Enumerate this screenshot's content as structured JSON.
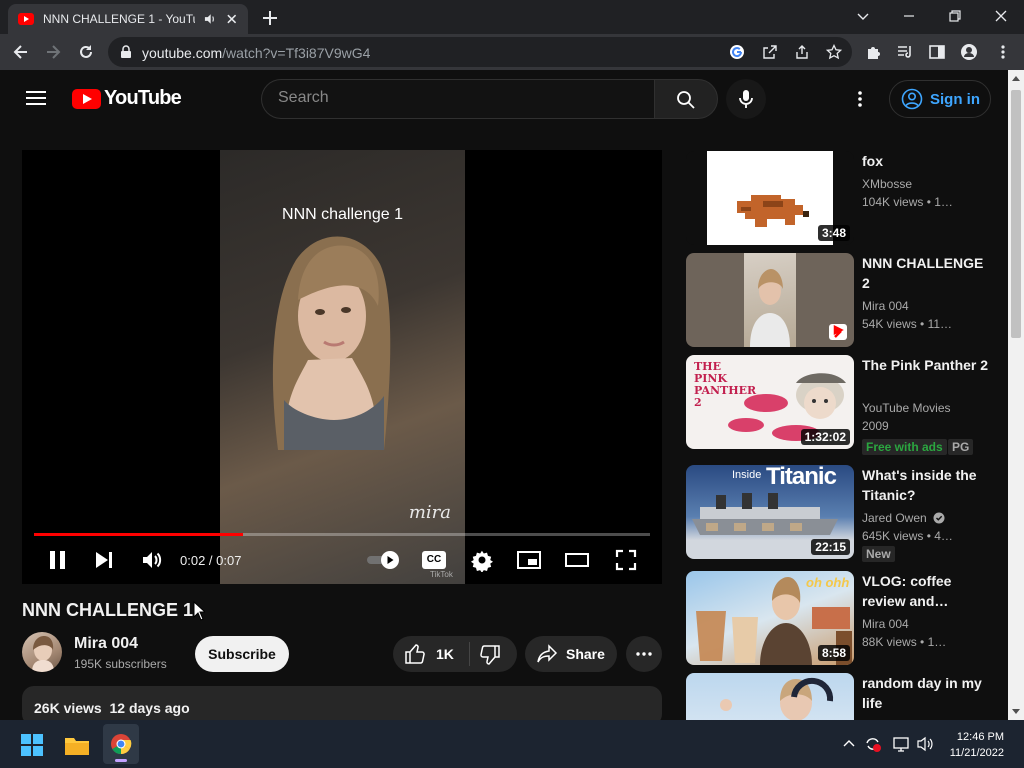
{
  "browser": {
    "tab_title": "NNN CHALLENGE 1 - YouTube",
    "url_domain": "youtube.com",
    "url_path": "/watch?v=Tf3i87V9wG4"
  },
  "header": {
    "logo_text": "YouTube",
    "search_placeholder": "Search",
    "signin_label": "Sign in"
  },
  "player": {
    "caption_text": "NNN challenge 1",
    "watermark": "mira",
    "tiktok_label": "TikTok",
    "timecode": "0:02 / 0:07",
    "cc_label": "CC",
    "progress": 0.34
  },
  "video": {
    "title": "NNN CHALLENGE 1",
    "channel": "Mira 004",
    "subscribers": "195K subscribers",
    "subscribe_label": "Subscribe",
    "likes": "1K",
    "share_label": "Share",
    "views": "26K views",
    "date": "12 days ago"
  },
  "sidebar": {
    "items": [
      {
        "title": "fox",
        "channel": "XMbosse",
        "views": "104K views",
        "age": "1…",
        "duration": "3:48"
      },
      {
        "title": "NNN CHALLENGE 2",
        "channel": "Mira 004",
        "views": "54K views",
        "age": "11…",
        "duration": ""
      },
      {
        "title": "The Pink Panther 2",
        "channel": "YouTube Movies",
        "views": "2009",
        "age": "",
        "duration": "1:32:02",
        "badge_free": "Free with ads",
        "badge_rating": "PG",
        "thumb_text": "THE PINK PANTHER 2"
      },
      {
        "title": "What's inside the Titanic?",
        "channel": "Jared Owen",
        "views": "645K views",
        "age": "4…",
        "duration": "22:15",
        "badge_new": "New",
        "thumb_text": "Titanic",
        "thumb_small": "Inside"
      },
      {
        "title": "VLOG: coffee review and…",
        "channel": "Mira 004",
        "views": "88K views",
        "age": "1…",
        "duration": "8:58",
        "thumb_text": "oh ohh"
      },
      {
        "title": "random day in my life",
        "channel": "",
        "views": "",
        "age": "",
        "duration": ""
      }
    ]
  },
  "taskbar": {
    "time": "12:46 PM",
    "date": "11/21/2022"
  },
  "colors": {
    "accent_red": "#ff0000",
    "link_blue": "#3ea6ff",
    "free_green": "#2ba640",
    "background": "#0f0f0f"
  }
}
